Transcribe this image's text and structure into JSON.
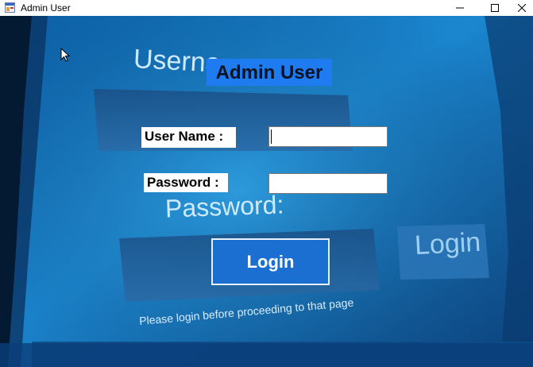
{
  "window": {
    "title": "Admin User",
    "controls": {
      "minimize_icon": "minimize-icon",
      "maximize_icon": "maximize-icon",
      "close_icon": "close-icon"
    }
  },
  "form": {
    "heading": "Admin User",
    "username_label": "User Name :",
    "username_value": "",
    "password_label": "Password :",
    "password_value": "",
    "login_button": "Login"
  },
  "background_image": {
    "username_text": "Userna",
    "password_text": "Password:",
    "login_text": "Login",
    "hint_text": "Please login before proceeding to that page"
  },
  "colors": {
    "heading_bg": "#1f7bf0",
    "button_bg": "#1a6fd0",
    "background": "#0a3f6e"
  }
}
